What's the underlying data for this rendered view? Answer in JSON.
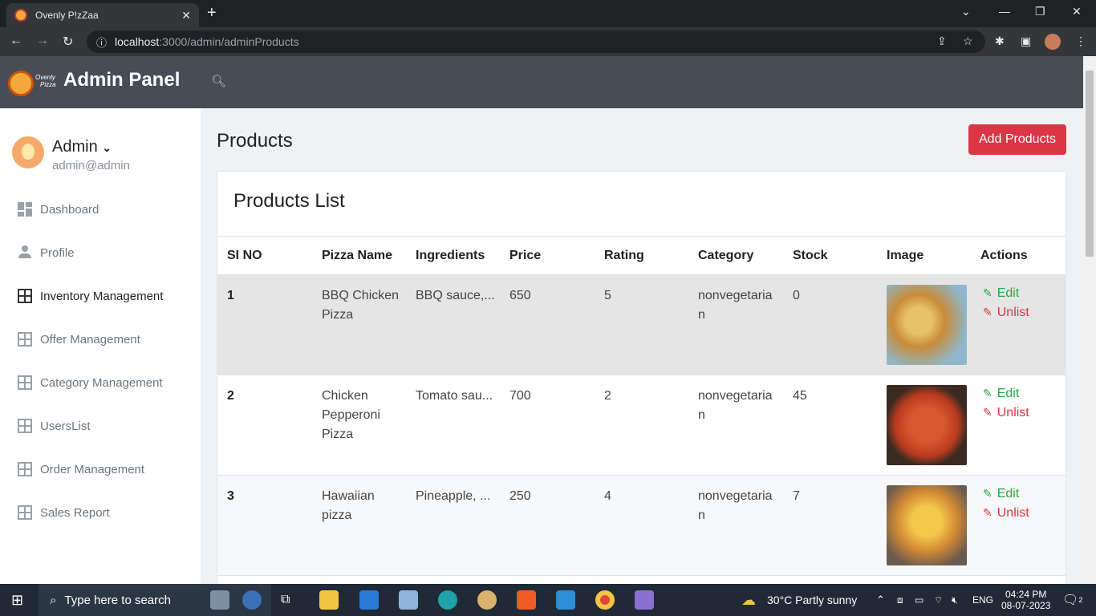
{
  "browser": {
    "tab_title": "Ovenly P!zZaa",
    "url_host": "localhost",
    "url_path": ":3000/admin/adminProducts"
  },
  "app": {
    "logo_text_1": "Ovenly",
    "logo_text_2": "Pizza",
    "brand": "Admin Panel"
  },
  "profile": {
    "name": "Admin",
    "email": "admin@admin"
  },
  "sidebar": {
    "items": [
      {
        "label": "Dashboard",
        "icon": "dashboard-icon"
      },
      {
        "label": "Profile",
        "icon": "user-icon"
      },
      {
        "label": "Inventory Management",
        "icon": "grid-icon"
      },
      {
        "label": "Offer Management",
        "icon": "grid-icon"
      },
      {
        "label": "Category Management",
        "icon": "grid-icon"
      },
      {
        "label": "UsersList",
        "icon": "grid-icon"
      },
      {
        "label": "Order Management",
        "icon": "grid-icon"
      },
      {
        "label": "Sales Report",
        "icon": "grid-icon"
      }
    ]
  },
  "main": {
    "title": "Products",
    "add_button": "Add Products",
    "card_title": "Products List",
    "columns": [
      "SI NO",
      "Pizza Name",
      "Ingredients",
      "Price",
      "Rating",
      "Category",
      "Stock",
      "Image",
      "Actions"
    ],
    "rows": [
      {
        "no": "1",
        "name": "BBQ Chicken Pizza",
        "ingredients": "BBQ sauce,...",
        "price": "650",
        "rating": "5",
        "category": "nonvegetarian",
        "stock": "0"
      },
      {
        "no": "2",
        "name": "Chicken Pepperoni Pizza",
        "ingredients": "Tomato sau...",
        "price": "700",
        "rating": "2",
        "category": "nonvegetarian",
        "stock": "45"
      },
      {
        "no": "3",
        "name": "Hawaiian pizza",
        "ingredients": "Pineapple, ...",
        "price": "250",
        "rating": "4",
        "category": "nonvegetarian",
        "stock": "7"
      }
    ],
    "edit_label": "Edit",
    "unlist_label": "Unlist"
  },
  "taskbar": {
    "search_placeholder": "Type here to search",
    "weather": "30°C  Partly sunny",
    "lang": "ENG",
    "time": "04:24 PM",
    "date": "08-07-2023",
    "notif_count": "2"
  },
  "colors": {
    "header_bg": "#474c57",
    "accent_red": "#dc3545",
    "edit_green": "#28a745",
    "row_highlight": "#e5e5e5"
  }
}
